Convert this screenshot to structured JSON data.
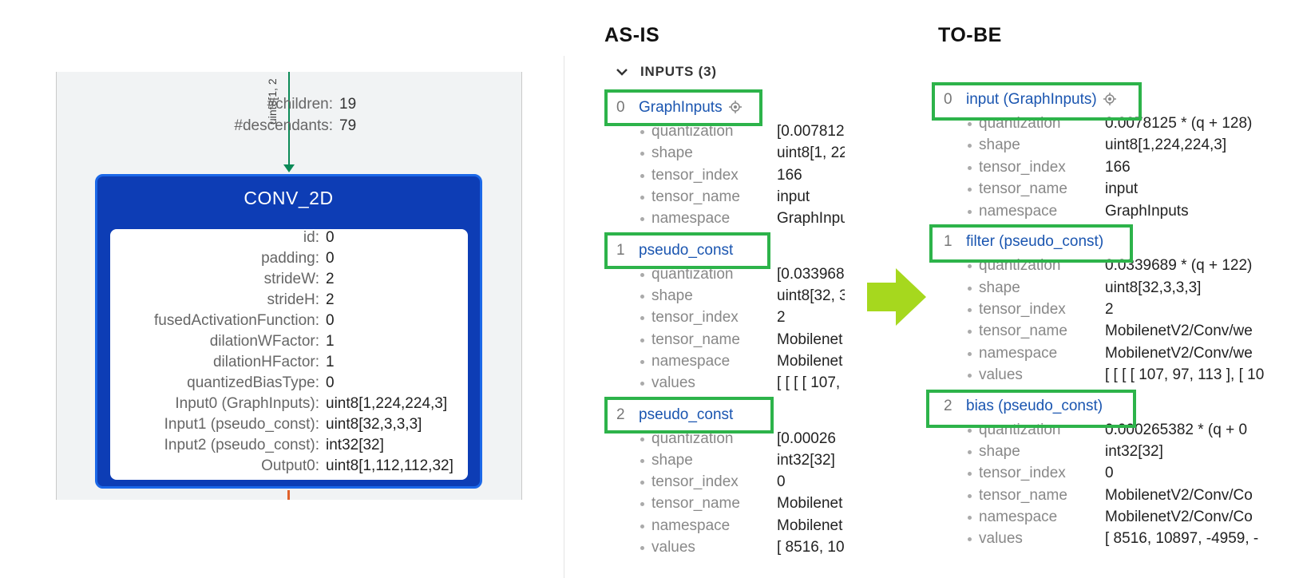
{
  "graph": {
    "edge_label": "uint8[1, 2",
    "stats": [
      {
        "key": "#children:",
        "value": "19"
      },
      {
        "key": "#descendants:",
        "value": "79"
      }
    ],
    "node": {
      "title": "CONV_2D",
      "attrs": [
        {
          "key": "id:",
          "value": "0"
        },
        {
          "key": "padding:",
          "value": "0"
        },
        {
          "key": "strideW:",
          "value": "2"
        },
        {
          "key": "strideH:",
          "value": "2"
        },
        {
          "key": "fusedActivationFunction:",
          "value": "0"
        },
        {
          "key": "dilationWFactor:",
          "value": "1"
        },
        {
          "key": "dilationHFactor:",
          "value": "1"
        },
        {
          "key": "quantizedBiasType:",
          "value": "0"
        },
        {
          "key": "Input0 (GraphInputs):",
          "value": "uint8[1,224,224,3]"
        },
        {
          "key": "Input1 (pseudo_const):",
          "value": "uint8[32,3,3,3]"
        },
        {
          "key": "Input2 (pseudo_const):",
          "value": "int32[32]"
        },
        {
          "key": "Output0:",
          "value": "uint8[1,112,112,32]"
        }
      ]
    }
  },
  "as_is": {
    "heading": "AS-IS",
    "section_title": "INPUTS (3)",
    "entries": [
      {
        "index": "0",
        "name": "GraphInputs",
        "locate_icon": "locate-icon",
        "fields": [
          {
            "key": "quantization",
            "value": "[0.007812"
          },
          {
            "key": "shape",
            "value": "uint8[1, 22"
          },
          {
            "key": "tensor_index",
            "value": "166"
          },
          {
            "key": "tensor_name",
            "value": "input"
          },
          {
            "key": "namespace",
            "value": "GraphInpu"
          }
        ]
      },
      {
        "index": "1",
        "name": "pseudo_const",
        "fields": [
          {
            "key": "quantization",
            "value": "[0.033968"
          },
          {
            "key": "shape",
            "value": "uint8[32, 3"
          },
          {
            "key": "tensor_index",
            "value": "2"
          },
          {
            "key": "tensor_name",
            "value": "Mobilenet"
          },
          {
            "key": "namespace",
            "value": "Mobilenet"
          },
          {
            "key": "values",
            "value": "[ [ [ [ 107,"
          }
        ]
      },
      {
        "index": "2",
        "name": "pseudo_const",
        "fields": [
          {
            "key": "quantization",
            "value": "[0.00026"
          },
          {
            "key": "shape",
            "value": "int32[32]"
          },
          {
            "key": "tensor_index",
            "value": "0"
          },
          {
            "key": "tensor_name",
            "value": "Mobilenet"
          },
          {
            "key": "namespace",
            "value": "Mobilenet"
          },
          {
            "key": "values",
            "value": "[ 8516, 108"
          }
        ]
      }
    ]
  },
  "to_be": {
    "heading": "TO-BE",
    "entries": [
      {
        "index": "0",
        "name": "input (GraphInputs)",
        "locate_icon": "locate-icon",
        "fields": [
          {
            "key": "quantization",
            "value": "0.0078125 * (q + 128)"
          },
          {
            "key": "shape",
            "value": "uint8[1,224,224,3]"
          },
          {
            "key": "tensor_index",
            "value": "166"
          },
          {
            "key": "tensor_name",
            "value": "input"
          },
          {
            "key": "namespace",
            "value": "GraphInputs"
          }
        ]
      },
      {
        "index": "1",
        "name": "filter (pseudo_const)",
        "fields": [
          {
            "key": "quantization",
            "value": "0.0339689 * (q + 122)"
          },
          {
            "key": "shape",
            "value": "uint8[32,3,3,3]"
          },
          {
            "key": "tensor_index",
            "value": "2"
          },
          {
            "key": "tensor_name",
            "value": "MobilenetV2/Conv/we"
          },
          {
            "key": "namespace",
            "value": "MobilenetV2/Conv/we"
          },
          {
            "key": "values",
            "value": "[ [ [ [ 107, 97, 113 ], [ 10"
          }
        ]
      },
      {
        "index": "2",
        "name": "bias (pseudo_const)",
        "fields": [
          {
            "key": "quantization",
            "value": "0.000265382 * (q + 0"
          },
          {
            "key": "shape",
            "value": "int32[32]"
          },
          {
            "key": "tensor_index",
            "value": "0"
          },
          {
            "key": "tensor_name",
            "value": "MobilenetV2/Conv/Co"
          },
          {
            "key": "namespace",
            "value": "MobilenetV2/Conv/Co"
          },
          {
            "key": "values",
            "value": "[ 8516, 10897, -4959, -"
          }
        ]
      }
    ]
  },
  "colors": {
    "highlight": "#2db34a",
    "arrow": "#a6d81e",
    "link": "#1a55b0",
    "node": "#0d3db5"
  }
}
